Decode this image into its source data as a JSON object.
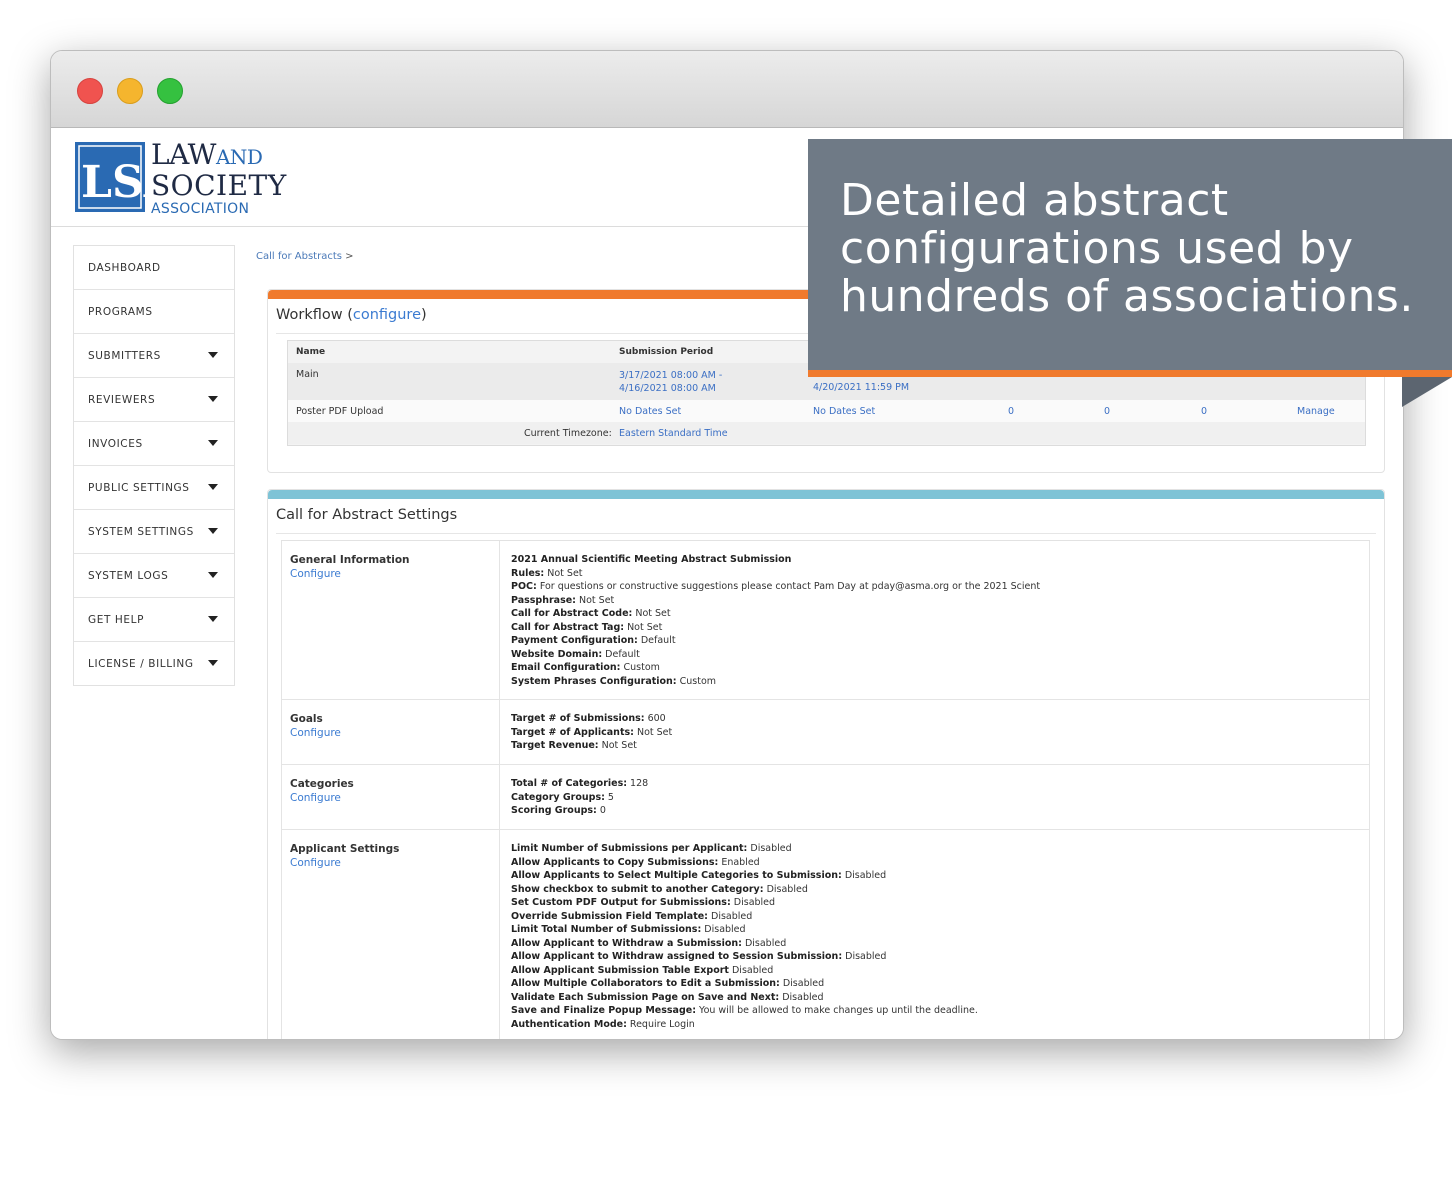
{
  "callout": {
    "line1": "Detailed abstract",
    "line2": "configurations used by",
    "line3": "hundreds of associations."
  },
  "logo": {
    "mark": "LSA",
    "law": "LAW",
    "and": "AND",
    "society": "SOCIETY",
    "association": "ASSOCIATION"
  },
  "sidebar": {
    "items": [
      {
        "label": "DASHBOARD",
        "has_caret": false
      },
      {
        "label": "PROGRAMS",
        "has_caret": false
      },
      {
        "label": "SUBMITTERS",
        "has_caret": true
      },
      {
        "label": "REVIEWERS",
        "has_caret": true
      },
      {
        "label": "INVOICES",
        "has_caret": true
      },
      {
        "label": "PUBLIC SETTINGS",
        "has_caret": true
      },
      {
        "label": "SYSTEM SETTINGS",
        "has_caret": true
      },
      {
        "label": "SYSTEM LOGS",
        "has_caret": true
      },
      {
        "label": "GET HELP",
        "has_caret": true
      },
      {
        "label": "LICENSE / BILLING",
        "has_caret": true
      }
    ]
  },
  "breadcrumb": {
    "item": "Call for Abstracts",
    "sep": ">"
  },
  "workflow": {
    "title": "Workflow",
    "open_paren": "(",
    "configure": "configure",
    "close_paren": ")",
    "headers": {
      "name": "Name",
      "period": "Submission Period"
    },
    "rows": [
      {
        "name": "Main",
        "period_line1": "3/17/2021 08:00 AM -",
        "period_line2": "4/16/2021 08:00 AM",
        "col3": "4/20/2021 11:59 PM"
      },
      {
        "name": "Poster PDF Upload",
        "period": "No Dates Set",
        "col3": "No Dates Set",
        "n1": "0",
        "n2": "0",
        "n3": "0",
        "action": "Manage"
      }
    ],
    "timezone_label": "Current Timezone:",
    "timezone_value": "Eastern Standard Time"
  },
  "settings": {
    "title": "Call for Abstract Settings",
    "configure_label": "Configure",
    "sections": {
      "general": {
        "title": "General Information",
        "lines": [
          {
            "k": "",
            "v": "2021 Annual Scientific Meeting Abstract Submission",
            "bold_all": true
          },
          {
            "k": "Rules:",
            "v": " Not Set"
          },
          {
            "k": "POC:",
            "v": " For questions or constructive suggestions please contact Pam Day at pday@asma.org or the 2021 Scient"
          },
          {
            "k": "Passphrase:",
            "v": " Not Set"
          },
          {
            "k": "Call for Abstract Code:",
            "v": " Not Set"
          },
          {
            "k": "Call for Abstract Tag:",
            "v": " Not Set"
          },
          {
            "k": "Payment Configuration:",
            "v": " Default"
          },
          {
            "k": "Website Domain:",
            "v": " Default"
          },
          {
            "k": "Email Configuration:",
            "v": " Custom"
          },
          {
            "k": "System Phrases Configuration:",
            "v": " Custom"
          }
        ]
      },
      "goals": {
        "title": "Goals",
        "lines": [
          {
            "k": "Target # of Submissions:",
            "v": " 600"
          },
          {
            "k": "Target # of Applicants:",
            "v": " Not Set"
          },
          {
            "k": "Target Revenue:",
            "v": " Not Set"
          }
        ]
      },
      "categories": {
        "title": "Categories",
        "lines": [
          {
            "k": "Total # of Categories:",
            "v": " 128"
          },
          {
            "k": "Category Groups:",
            "v": " 5"
          },
          {
            "k": "Scoring Groups:",
            "v": " 0"
          }
        ]
      },
      "applicant": {
        "title": "Applicant Settings",
        "lines": [
          {
            "k": "Limit Number of Submissions per Applicant:",
            "v": " Disabled"
          },
          {
            "k": "Allow Applicants to Copy Submissions:",
            "v": " Enabled"
          },
          {
            "k": "Allow Applicants to Select Multiple Categories to Submission:",
            "v": " Disabled"
          },
          {
            "k": "Show checkbox to submit to another Category:",
            "v": " Disabled"
          },
          {
            "k": "Set Custom PDF Output for Submissions:",
            "v": " Disabled"
          },
          {
            "k": "Override Submission Field Template:",
            "v": " Disabled"
          },
          {
            "k": "Limit Total Number of Submissions:",
            "v": " Disabled"
          },
          {
            "k": "Allow Applicant to Withdraw a Submission:",
            "v": " Disabled"
          },
          {
            "k": "Allow Applicant to Withdraw assigned to Session Submission:",
            "v": " Disabled"
          },
          {
            "k": "Allow Applicant Submission Table Export",
            "v": " Disabled"
          },
          {
            "k": "Allow Multiple Collaborators to Edit a Submission:",
            "v": " Disabled"
          },
          {
            "k": "Validate Each Submission Page on Save and Next:",
            "v": " Disabled"
          },
          {
            "k": "Save and Finalize Popup Message:",
            "v": " You will be allowed to make changes up until the deadline."
          },
          {
            "k": "Authentication Mode:",
            "v": " Require Login"
          }
        ]
      }
    }
  }
}
